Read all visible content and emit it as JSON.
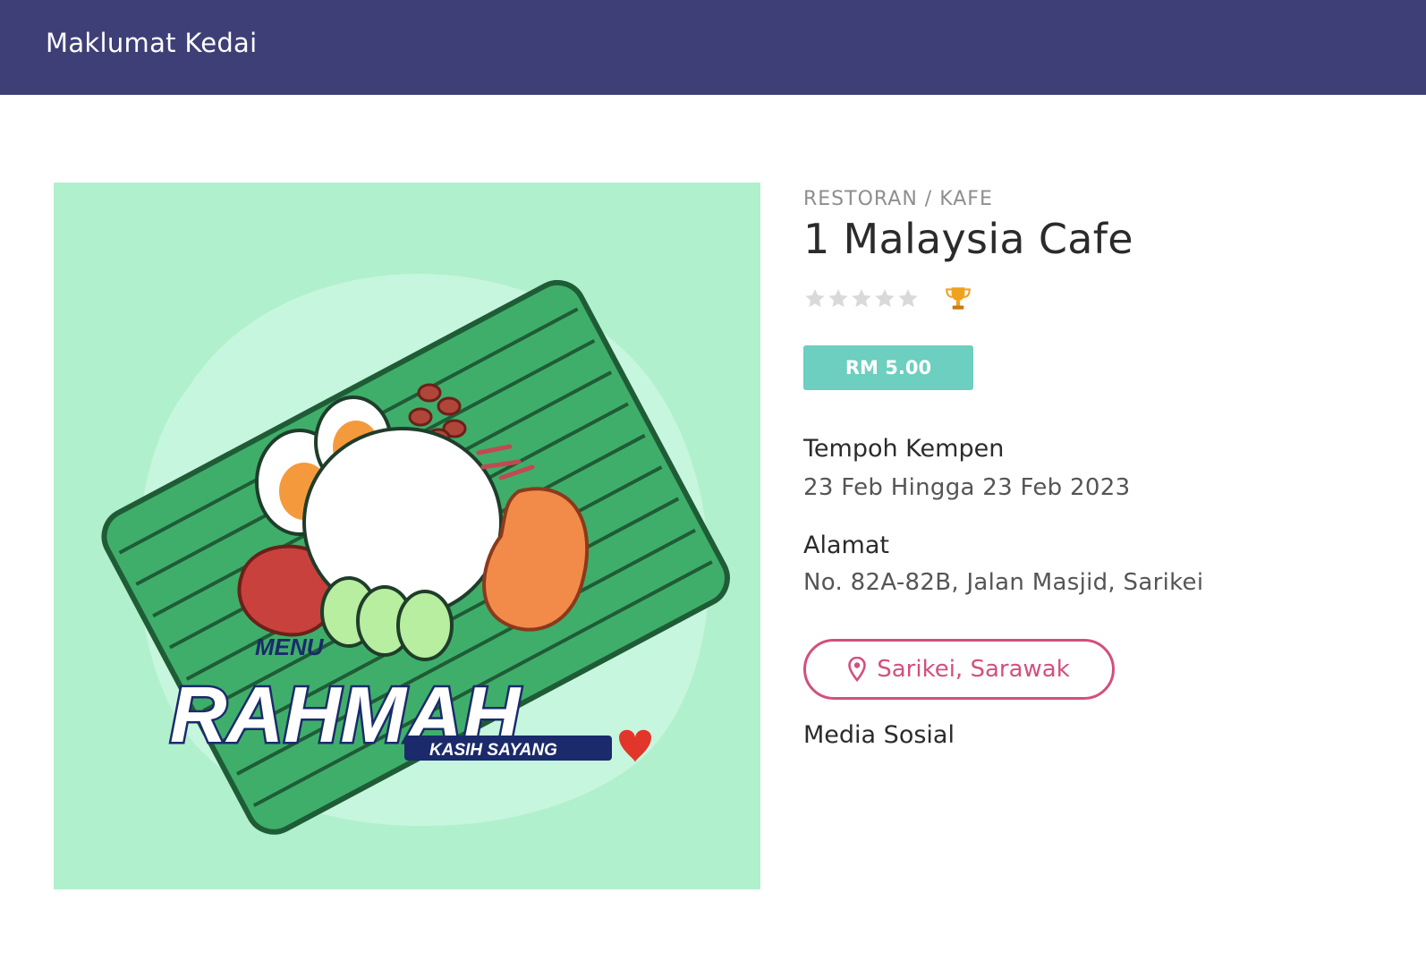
{
  "header": {
    "title": "Maklumat Kedai"
  },
  "shop": {
    "category": "RESTORAN / KAFE",
    "name": "1 Malaysia Cafe",
    "rating": {
      "value": 0,
      "max": 5
    },
    "price": "RM 5.00",
    "campaign_label": "Tempoh Kempen",
    "campaign_value": "23 Feb Hingga 23 Feb 2023",
    "address_label": "Alamat",
    "address_value": "No. 82A-82B, Jalan Masjid, Sarikei",
    "location_button": "Sarikei, Sarawak",
    "social_label": "Media Sosial"
  },
  "image": {
    "logo_top": "MENU",
    "logo_main": "RAHMAH",
    "logo_sub": "KASIH SAYANG"
  },
  "colors": {
    "header_bg": "#3f3f77",
    "price_bg": "#6ccfc0",
    "location_accent": "#d2507e",
    "image_bg": "#b0f0cd"
  },
  "icons": {
    "star": "star-icon",
    "trophy": "trophy-icon",
    "location": "map-pin-icon"
  }
}
